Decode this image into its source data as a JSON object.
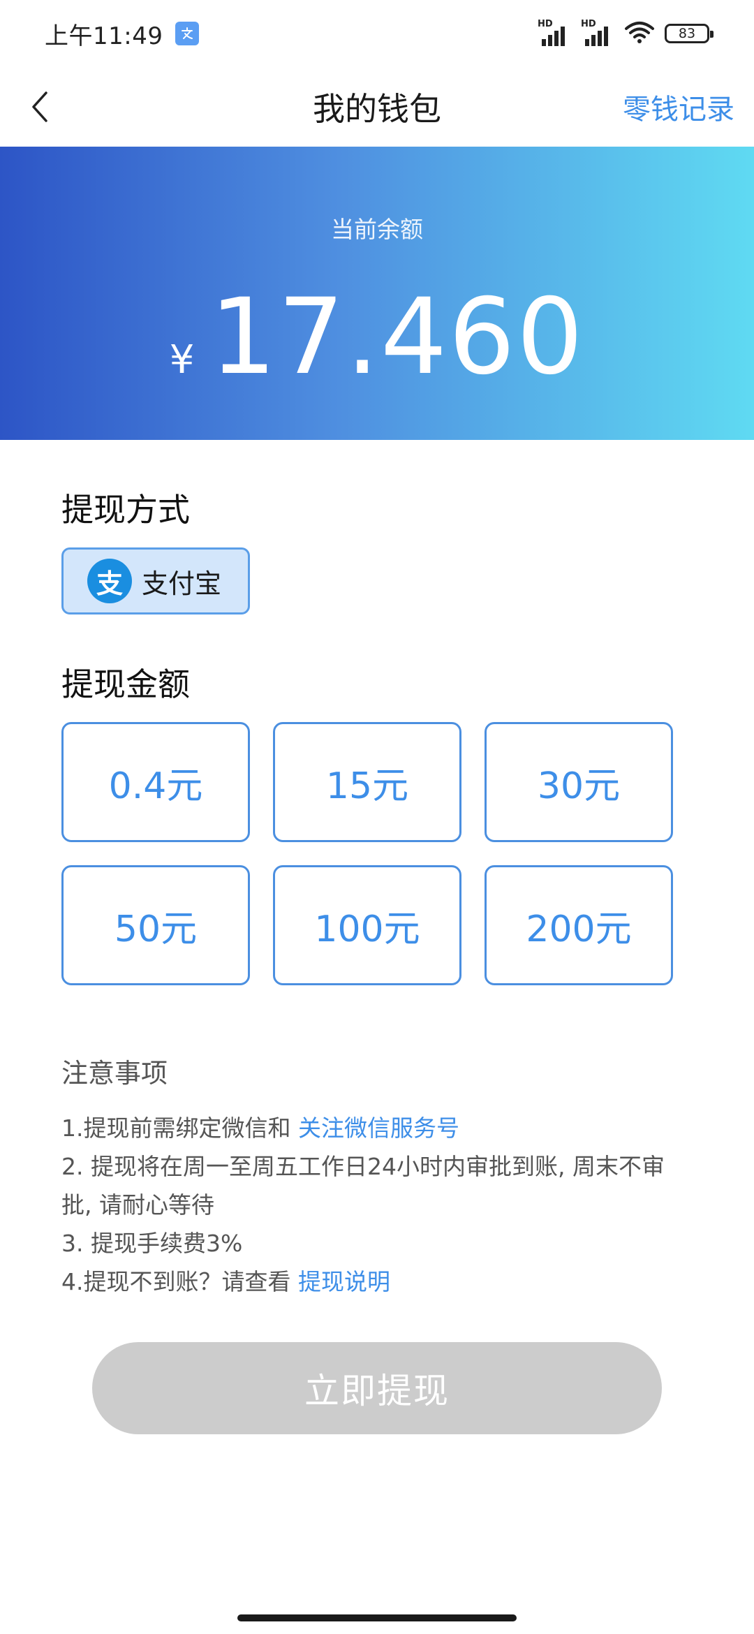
{
  "status_bar": {
    "time": "上午11:49",
    "hd1": "HD",
    "hd2": "HD",
    "battery": "83"
  },
  "header": {
    "title": "我的钱包",
    "right_link": "零钱记录",
    "back_icon": "chevron-left-icon"
  },
  "balance": {
    "label": "当前余额",
    "currency": "¥",
    "amount": "17.460"
  },
  "withdraw_method": {
    "title": "提现方式",
    "options": [
      {
        "label": "支付宝",
        "icon": "alipay-icon",
        "logo_char": "支",
        "selected": true
      }
    ]
  },
  "withdraw_amount": {
    "title": "提现金额",
    "options": [
      "0.4元",
      "15元",
      "30元",
      "50元",
      "100元",
      "200元"
    ]
  },
  "notes": {
    "title": "注意事项",
    "line1_text": "1.提现前需绑定微信和 ",
    "line1_link": "关注微信服务号",
    "line2_text": "2. 提现将在周一至周五工作日24小时内审批到账, 周末不审批, 请耐心等待",
    "line3_text": "3. 提现手续费3%",
    "line4_text": "4.提现不到账？请查看 ",
    "line4_link": "提现说明"
  },
  "submit": {
    "label": "立即提现",
    "enabled": false
  },
  "colors": {
    "accent": "#3d8ee8",
    "banner_start": "#2d55c6",
    "banner_end": "#5fdaf2",
    "disabled_button": "#cccccc"
  }
}
